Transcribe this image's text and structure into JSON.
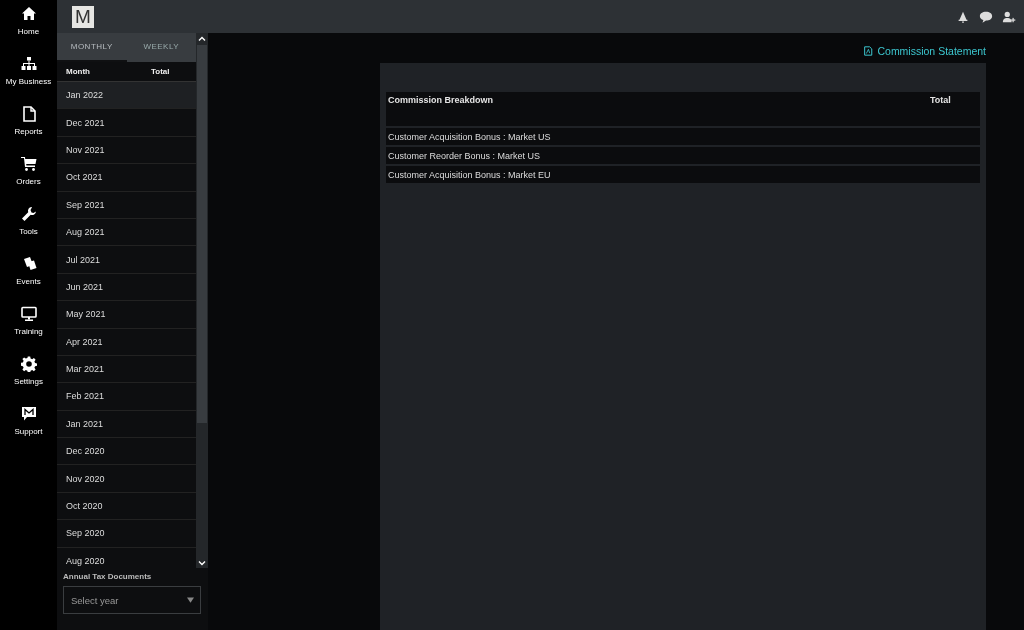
{
  "nav": [
    {
      "label": "Home"
    },
    {
      "label": "My Business"
    },
    {
      "label": "Reports"
    },
    {
      "label": "Orders"
    },
    {
      "label": "Tools"
    },
    {
      "label": "Events"
    },
    {
      "label": "Training"
    },
    {
      "label": "Settings"
    },
    {
      "label": "Support"
    }
  ],
  "top_bar": {
    "logo": "M"
  },
  "period_tabs": [
    {
      "label": "MONTHLY",
      "selected": true
    },
    {
      "label": "WEEKLY",
      "selected": false
    }
  ],
  "months": {
    "columns": [
      "Month",
      "Total"
    ],
    "rows": [
      {
        "month": "Jan 2022",
        "selected": true
      },
      {
        "month": "Dec 2021",
        "selected": false
      },
      {
        "month": "Nov 2021",
        "selected": false
      },
      {
        "month": "Oct 2021",
        "selected": false
      },
      {
        "month": "Sep 2021",
        "selected": false
      },
      {
        "month": "Aug 2021",
        "selected": false
      },
      {
        "month": "Jul 2021",
        "selected": false
      },
      {
        "month": "Jun 2021",
        "selected": false
      },
      {
        "month": "May 2021",
        "selected": false
      },
      {
        "month": "Apr 2021",
        "selected": false
      },
      {
        "month": "Mar 2021",
        "selected": false
      },
      {
        "month": "Feb 2021",
        "selected": false
      },
      {
        "month": "Jan 2021",
        "selected": false
      },
      {
        "month": "Dec 2020",
        "selected": false
      },
      {
        "month": "Nov 2020",
        "selected": false
      },
      {
        "month": "Oct 2020",
        "selected": false
      },
      {
        "month": "Sep 2020",
        "selected": false
      },
      {
        "month": "Aug 2020",
        "selected": false
      }
    ]
  },
  "tax_documents": {
    "label": "Annual Tax Documents",
    "placeholder": "Select year"
  },
  "statement_link": "Commission Statement",
  "breakdown": {
    "columns": [
      "Commission Breakdown",
      "Total"
    ],
    "rows": [
      "Customer Acquisition Bonus : Market US",
      "Customer Reorder Bonus : Market US",
      "Customer Acquisition Bonus : Market EU"
    ]
  }
}
